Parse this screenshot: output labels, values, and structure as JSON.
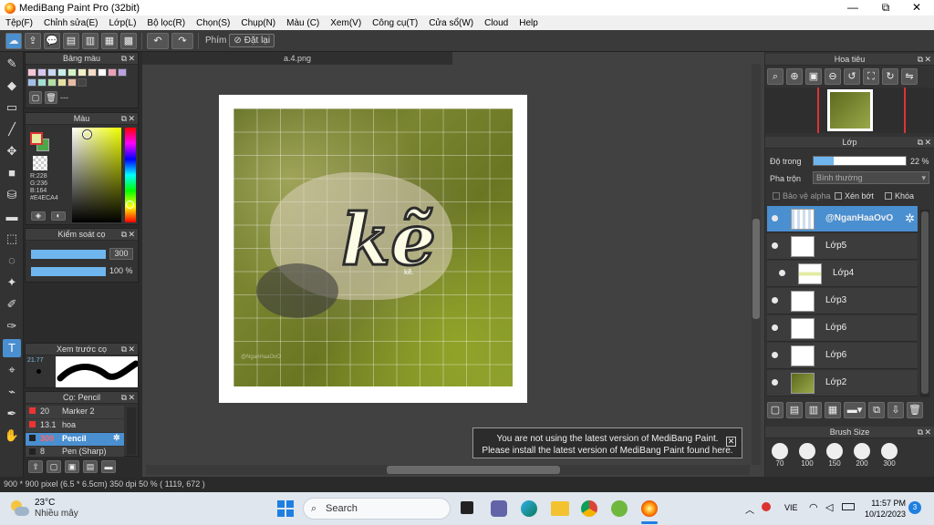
{
  "window": {
    "title": "MediBang Paint Pro (32bit)",
    "minimize": "—",
    "maximize": "⧉",
    "close": "✕"
  },
  "menu": [
    "Tệp(F)",
    "Chỉnh sửa(E)",
    "Lớp(L)",
    "Bộ lọc(R)",
    "Chọn(S)",
    "Chụp(N)",
    "Màu (C)",
    "Xem(V)",
    "Công cụ(T)",
    "Cửa sổ(W)",
    "Cloud",
    "Help"
  ],
  "toolbar": {
    "shortcut_label": "Phím",
    "reset_label": "Đặt lại"
  },
  "palette_panel": {
    "title": "Bảng màu",
    "extra": "---"
  },
  "color_panel": {
    "title": "Màu",
    "r": "R:228",
    "g": "G:236",
    "b": "B:164",
    "hex": "#E4ECA4",
    "fg_color": "#E4ECA4",
    "bg_color": "#4aa84a"
  },
  "brush_control": {
    "title": "Kiểm soát cọ",
    "size": "300",
    "opacity": "100 %"
  },
  "brush_preview": {
    "title": "Xem trước cọ",
    "size_readout": "21.77"
  },
  "brush_list": {
    "title": "Cọ: Pencil",
    "items": [
      {
        "size": "20",
        "name": "Marker 2"
      },
      {
        "size": "13.1",
        "name": "hoa"
      },
      {
        "size": "300",
        "name": "Pencil"
      },
      {
        "size": "8",
        "name": "Pen (Sharp)"
      }
    ]
  },
  "document": {
    "tab": "a.4.png",
    "art_title": "kẽ",
    "art_sub": "kẽ.",
    "watermark": "@NganHaaOvO"
  },
  "navigator": {
    "title": "Hoa tiêu"
  },
  "layer_panel": {
    "title": "Lớp",
    "opacity_label": "Độ trong",
    "opacity_value": "22 %",
    "opacity": 0.22,
    "blend_label": "Pha trộn",
    "blend_value": "Bình thường",
    "protect_alpha": "Bảo vệ alpha",
    "clipping": "Xén bớt",
    "lock": "Khóa",
    "layers": [
      {
        "name": "@NganHaaOvO",
        "selected": true
      },
      {
        "name": "Lớp5",
        "selected": false
      },
      {
        "name": "Lớp4",
        "selected": false
      },
      {
        "name": "Lớp3",
        "selected": false
      },
      {
        "name": "Lớp6",
        "selected": false
      },
      {
        "name": "Lớp6",
        "selected": false
      },
      {
        "name": "Lớp2",
        "selected": false
      }
    ]
  },
  "brush_size_panel": {
    "title": "Brush Size",
    "sizes": [
      "70",
      "100",
      "150",
      "200",
      "300"
    ]
  },
  "notice": {
    "line1": "You are not using the latest version of MediBang Paint.",
    "line2": "Please install the latest version of MediBang Paint found here."
  },
  "status": {
    "text": "900 * 900 pixel   (6.5 * 6.5cm)   350 dpi   50 %   ( 1119, 672 )"
  },
  "taskbar": {
    "weather_temp": "23°C",
    "weather_desc": "Nhiều mây",
    "search_placeholder": "Search",
    "lang": "VIE",
    "time": "11:57 PM",
    "date": "10/12/2023",
    "badge": "3"
  }
}
